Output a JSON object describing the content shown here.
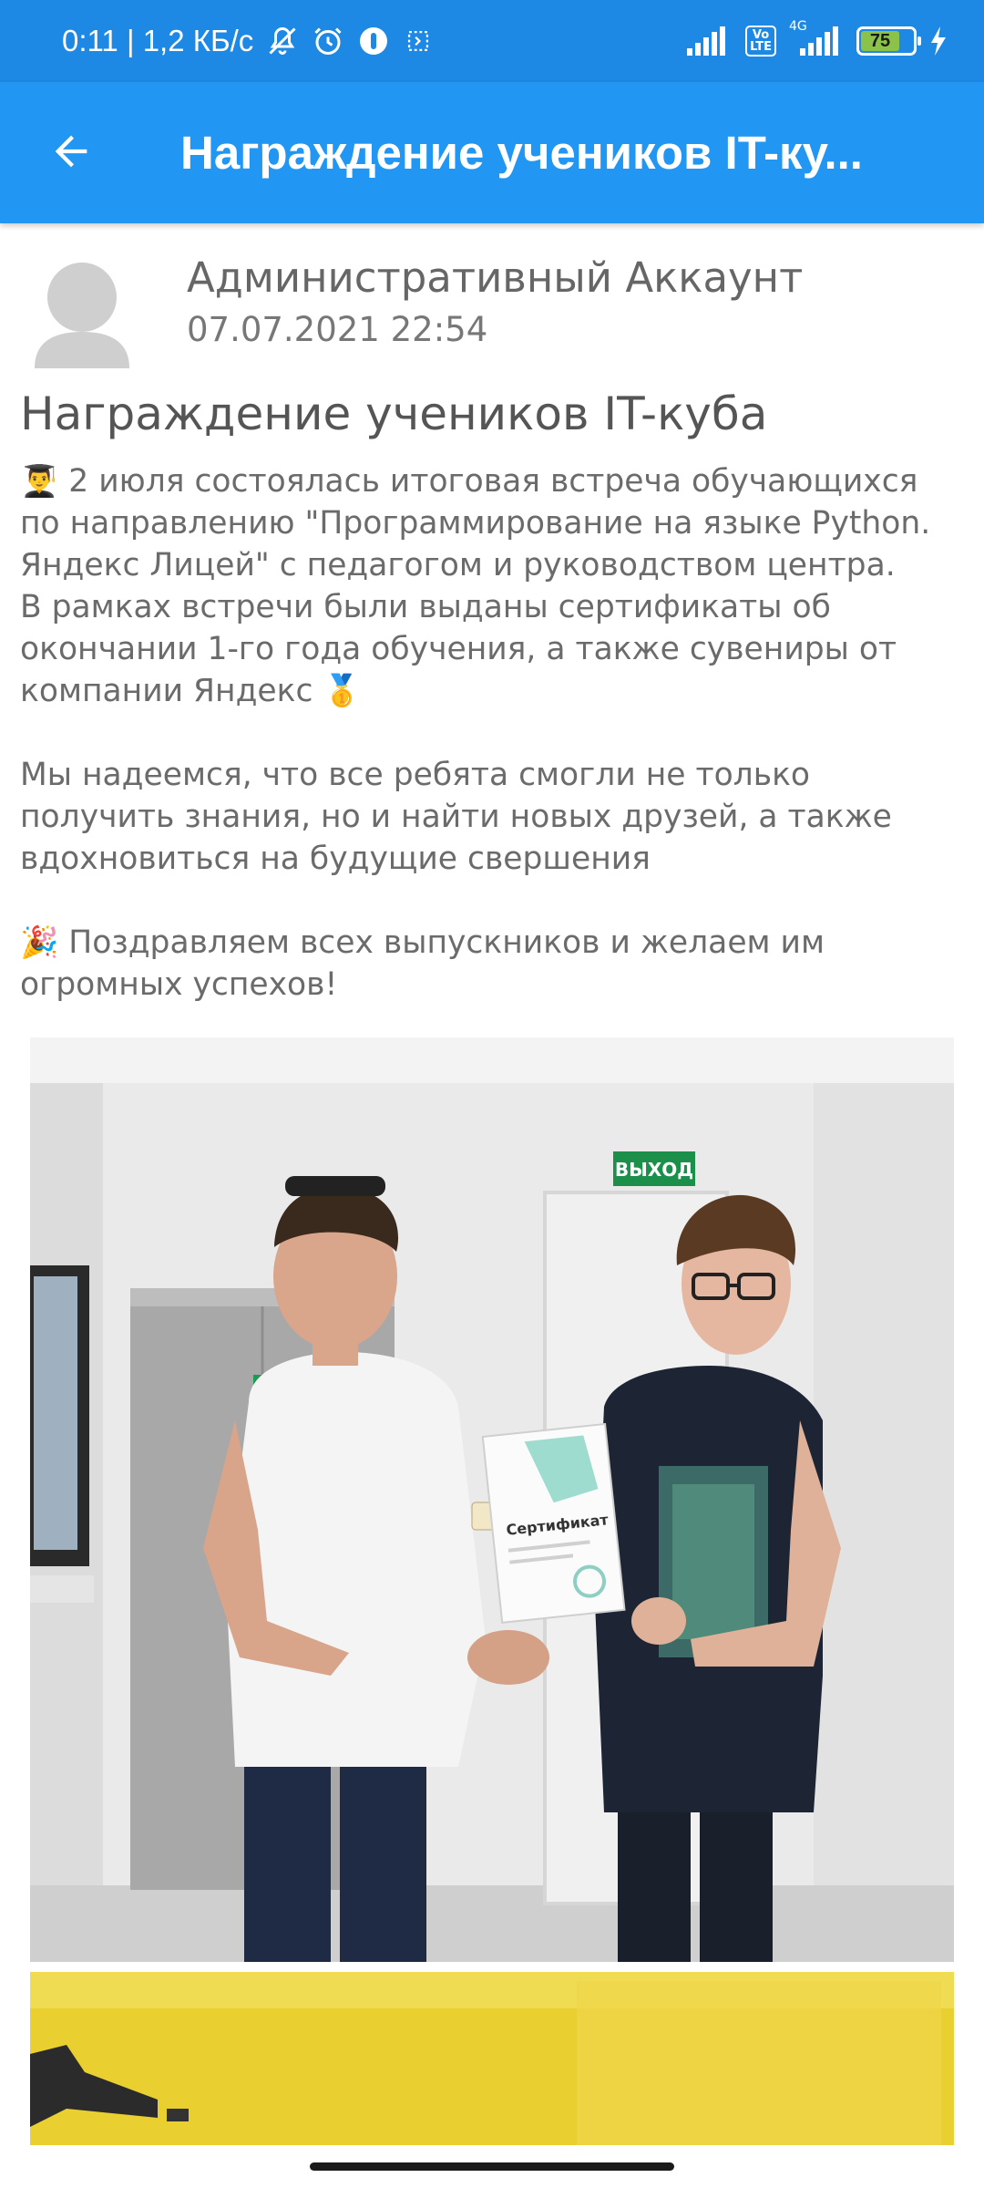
{
  "status_bar": {
    "time_speed": "0:11 | 1,2 КБ/с",
    "volte_label": "Vo\nLTE",
    "network_label": "4G",
    "battery": "75"
  },
  "app_bar": {
    "title": "Награждение учеников IT-ку..."
  },
  "author": {
    "name": "Административный Аккаунт",
    "date": "07.07.2021 22:54"
  },
  "post": {
    "title": "Награждение учеников IT-куба",
    "p1_emoji": "👨‍🎓",
    "p1": " 2 июля состоялась итоговая встреча обучающихся по направлению \"Программирование на языке Python. Яндекс Лицей\" с педагогом и руководством центра.",
    "p2": "В рамках встречи были выданы сертификаты об окончании 1-го года обучения, а также сувениры от компании Яндекс ",
    "p2_emoji": "🥇",
    "p3": "Мы надеемся, что все ребята смогли не только получить знания, но и найти новых друзей, а также вдохновиться на будущие свершения",
    "p4_emoji": "🎉",
    "p4": " Поздравляем всех выпускников и желаем им огромных успехов!"
  },
  "photo": {
    "exit_sign": "ВЫХОД",
    "certificate_title": "Сертификат"
  },
  "colors": {
    "status_bar": "#1e88e5",
    "app_bar": "#2196f3",
    "text": "#6b6b6b"
  }
}
